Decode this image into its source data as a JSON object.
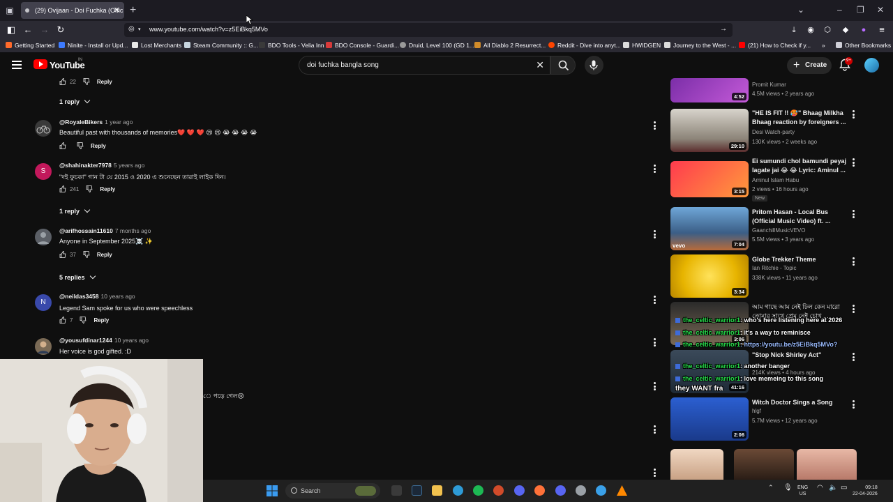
{
  "browser": {
    "tab_title": "(29) Ovijaan - Doi Fuchka (Offic",
    "tab_close": "✕",
    "new_tab": "+",
    "url": "www.youtube.com/watch?v=z5EiBkq5MVo",
    "bookmarks": [
      {
        "label": "Getting Started",
        "color": "#ff6a2b"
      },
      {
        "label": "Ninite - Install or Upd...",
        "color": "#3d7bff"
      },
      {
        "label": "Lost Merchants",
        "color": "#e8e8e8"
      },
      {
        "label": "Steam Community :: G...",
        "color": "#c7d5e0"
      },
      {
        "label": "BDO Tools - Velia Inn",
        "color": "#3a3a3a"
      },
      {
        "label": "BDO Console - Guardi...",
        "color": "#d83a3a"
      },
      {
        "label": "Druid, Level 100 (GD 1...",
        "color": "#9a9a9a"
      },
      {
        "label": "All Diablo 2 Resurrect...",
        "color": "#d18b2a"
      },
      {
        "label": "Reddit - Dive into anyt...",
        "color": "#ff4500"
      },
      {
        "label": "HWIDGEN",
        "color": "#dddddd"
      },
      {
        "label": "Journey to the West - ...",
        "color": "#dddddd"
      },
      {
        "label": "(21) How to Check if y...",
        "color": "#ff0000"
      }
    ],
    "other_bookmarks": "Other Bookmarks"
  },
  "youtube": {
    "logo_text": "YouTube",
    "region": "IN",
    "search_query": "doi fuchka bangla song",
    "create_label": "Create",
    "notif_badge": "9+"
  },
  "comments": [
    {
      "avatar": "",
      "avatar_color": "",
      "user": "",
      "time": "",
      "text": "",
      "likes": "22",
      "reply": "Reply",
      "partial": true
    },
    {
      "avatar": "",
      "avatar_color": "#4a4a4a",
      "user": "@RoyaleBikers",
      "time": "1 year ago",
      "text": "Beautiful past with thousands of memories❤️ ❤️ ❤️ 😢 😢 😭 😭 😭 😭",
      "likes": "",
      "reply": "Reply"
    },
    {
      "avatar": "S",
      "avatar_color": "#c2185b",
      "user": "@shahinakter7978",
      "time": "5 years ago",
      "text": "\"দই ফুচকা\" গান টা যে 2015 ও 2020 এ শুনেছেন তারাই লাইক দিন।",
      "likes": "241",
      "reply": "Reply"
    },
    {
      "avatar": "",
      "avatar_color": "#5b5f66",
      "user": "@arifhossain11610",
      "time": "7 months ago",
      "text": "Anyone in September 2025☠️ ✨",
      "likes": "37",
      "reply": "Reply"
    },
    {
      "avatar": "N",
      "avatar_color": "#3949ab",
      "user": "@neildas3458",
      "time": "10 years ago",
      "text": "Legend Sam spoke for us who were speechless",
      "likes": "7",
      "reply": "Reply"
    },
    {
      "avatar": "",
      "avatar_color": "#7a6a55",
      "user": "@yousufdinar1244",
      "time": "10 years ago",
      "text": "Her voice is god gifted. :D",
      "likes": "",
      "reply": ""
    }
  ],
  "replies_toggles": [
    "1 reply",
    "1 reply",
    "5 replies"
  ],
  "partial_comment_text": "ে পড়ে গেল😢",
  "sidebar_videos": [
    {
      "title": "",
      "channel": "Promit Kumar",
      "meta": "4.5M views • 2 years ago",
      "duration": "4:52",
      "is_new": false,
      "thumb": "linear-gradient(135deg,#7b2ea8,#c45ad8)"
    },
    {
      "title": "\"HE IS FIT !! 🥵\" Bhaag Milkha Bhaag reaction by foreigners ...",
      "channel": "Desi Watch-party",
      "meta": "130K views • 2 weeks ago",
      "duration": "29:10",
      "is_new": false,
      "thumb": "linear-gradient(180deg,#d8d4cc,#8c8478 70%,#5a2d2d)"
    },
    {
      "title": "Ei sumundi chol bamundi peyaj lagate jai 😂 😂 Lyric: Aminul ...",
      "channel": "Aminul Islam Habu",
      "meta": "2 views • 16 hours ago",
      "duration": "3:15",
      "is_new": true,
      "thumb": "linear-gradient(135deg,#ff3b4e,#ff9a3c)"
    },
    {
      "title": "Pritom Hasan - Local Bus (Official Music Video) ft. ...",
      "channel": "GaanchillMusicVEVO",
      "meta": "5.5M views • 3 years ago",
      "duration": "7:04",
      "is_new": false,
      "thumb": "linear-gradient(180deg,#6fa7d8,#3b5e86 60%,#b76b3a)"
    },
    {
      "title": "Globe Trekker Theme",
      "channel": "Ian Ritchie - Topic",
      "meta": "338K views • 11 years ago",
      "duration": "3:34",
      "is_new": false,
      "thumb": "radial-gradient(circle,#ffe25a,#e7b400 60%,#b88600)"
    },
    {
      "title": "আম গাছে আম নেই ঢিল কেন মারো তোমার সাথে প্রেম নেই চোখ ...",
      "channel": "",
      "meta": "",
      "duration": "3:06",
      "is_new": false,
      "thumb": "linear-gradient(180deg,#2a2a2a,#7a6a55)"
    },
    {
      "title": "\"Stop Nick Shirley Act\"",
      "channel": "",
      "meta": "214K views • 4 hours ago",
      "duration": "41:16",
      "is_new": true,
      "thumb": "linear-gradient(180deg,#3b4a5a,#1e2a36)"
    },
    {
      "title": "Witch Doctor Sings a Song",
      "channel": "hlgf",
      "meta": "5.7M views • 12 years ago",
      "duration": "2:06",
      "is_new": false,
      "thumb": "linear-gradient(180deg,#2b5fd1,#1a3a8a)"
    }
  ],
  "chat_overlay": [
    {
      "user": "the_celtic_warrior1",
      "message": ": who's here listening here at 2026"
    },
    {
      "user": "the_celtic_warrior1",
      "message": ": it's a way to reminisce"
    },
    {
      "user": "the_celtic_warrior1",
      "message": ": https://youtu.be/z5EiBkq5MVo?"
    },
    {
      "user": "the_celtic_warrior1",
      "message": ": another banger"
    },
    {
      "user": "the_celtic_warrior1",
      "message": ": love memeing to this song"
    },
    {
      "user": "",
      "message": "they WANT fra"
    }
  ],
  "taskbar": {
    "search_label": "Search",
    "lang_top": "ENG",
    "lang_bottom": "US",
    "time": "09:18",
    "date": "22-04-2026",
    "icons": [
      {
        "name": "steam-icon",
        "color": "#1b2838"
      },
      {
        "name": "file-explorer-icon",
        "color": "#f2c14e"
      },
      {
        "name": "edge-icon",
        "color": "#2e9bd6"
      },
      {
        "name": "spotify-icon",
        "color": "#1db954"
      },
      {
        "name": "app-red-icon",
        "color": "#d14b2a"
      },
      {
        "name": "app-purple-icon",
        "color": "#5865f2"
      },
      {
        "name": "firefox-icon",
        "color": "#ff7139"
      },
      {
        "name": "discord-icon",
        "color": "#5865f2"
      },
      {
        "name": "settings-icon",
        "color": "#9aa0a6"
      },
      {
        "name": "app-blue-icon",
        "color": "#3aa0e8"
      },
      {
        "name": "vlc-icon",
        "color": "#ff8800"
      }
    ]
  }
}
